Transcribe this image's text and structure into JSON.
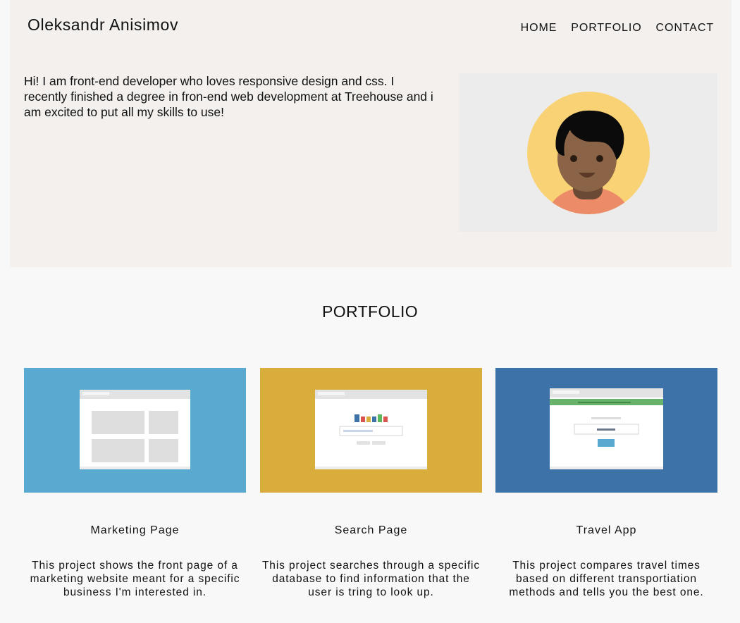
{
  "header": {
    "brand": "Oleksandr Anisimov",
    "nav": [
      "HOME",
      "PORTFOLIO",
      "CONTACT"
    ]
  },
  "hero": {
    "intro": "Hi! I am front-end developer who loves responsive design and css. I recently finished a degree in fron-end web development at Treehouse and i am excited to put all my skills to use!",
    "avatar_icon": "person-avatar-icon"
  },
  "portfolio": {
    "title": "PORTFOLIO",
    "projects": [
      {
        "title": "Marketing Page",
        "description": "This project shows the front page of a marketing website meant for a specific business I'm interested in.",
        "thumb_color": "#5aa9d0",
        "thumb_icon": "marketing-layout-icon"
      },
      {
        "title": "Search Page",
        "description": "This project searches through a specific database to find information that the user is tring to look up.",
        "thumb_color": "#d9ad3c",
        "thumb_icon": "search-page-icon"
      },
      {
        "title": "Travel App",
        "description": "This project compares travel times based on different transportiation methods and tells you the best one.",
        "thumb_color": "#3d72a9",
        "thumb_icon": "travel-app-icon"
      }
    ]
  },
  "colors": {
    "hero_bg": "#f3f0ee",
    "avatar_panel_bg": "#ececec",
    "avatar_circle": "#f8d275",
    "page_bg": "#f8f8f8"
  }
}
